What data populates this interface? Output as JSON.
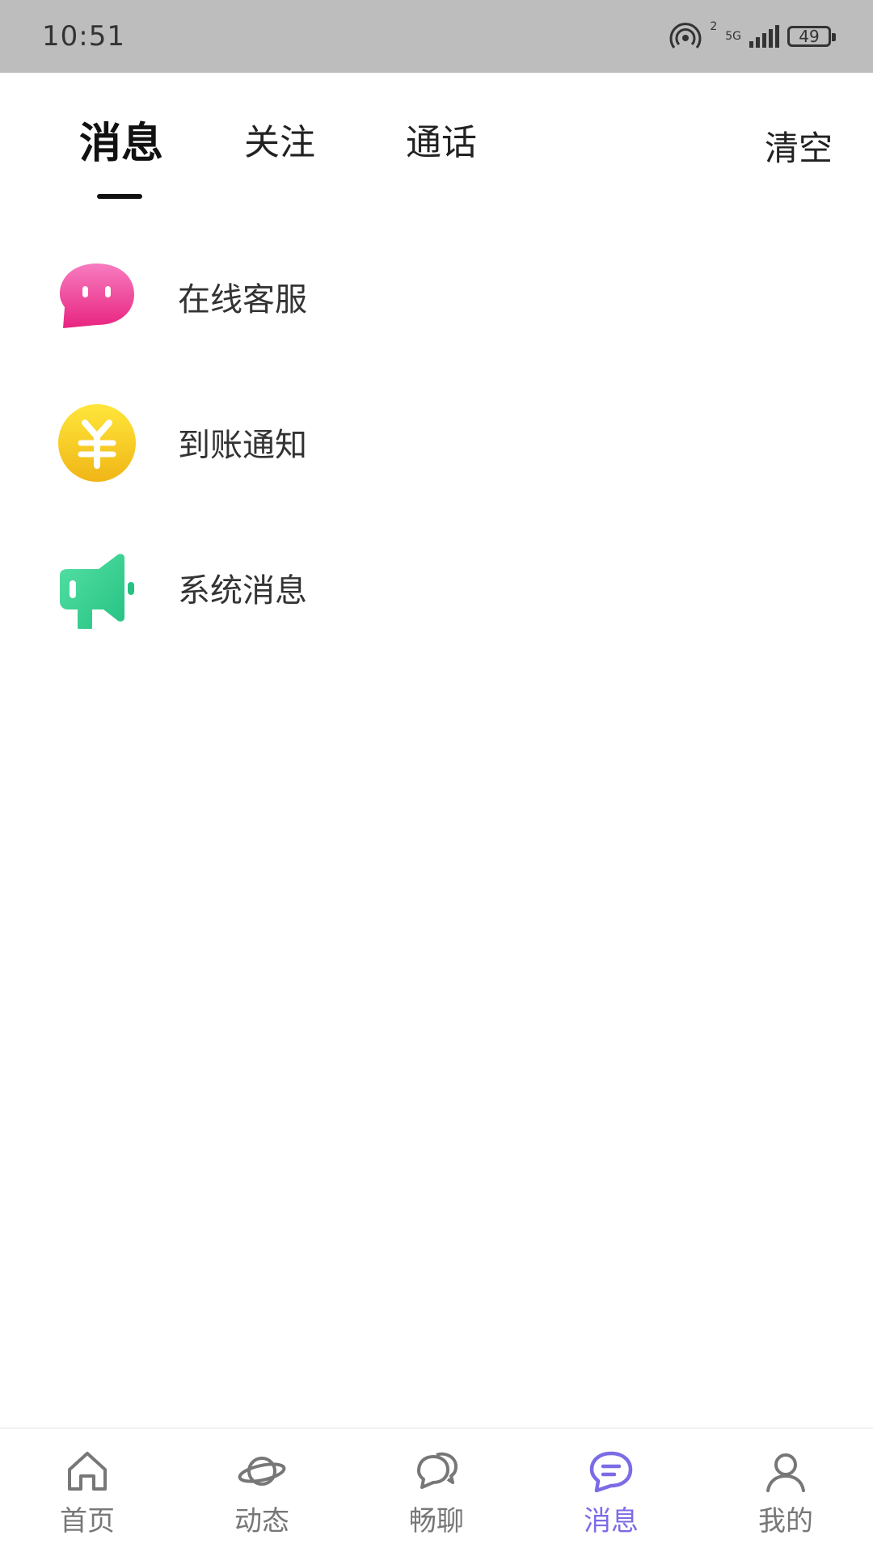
{
  "status_bar": {
    "time": "10:51",
    "net_sup": "2",
    "net_type": "5G",
    "battery": "49"
  },
  "tabs": [
    {
      "label": "消息",
      "active": true
    },
    {
      "label": "关注",
      "active": false
    },
    {
      "label": "通话",
      "active": false
    }
  ],
  "clear_label": "清空",
  "list": [
    {
      "label": "在线客服",
      "icon": "customer-service-bubble-icon",
      "color": "#ee3f9a"
    },
    {
      "label": "到账通知",
      "icon": "yuan-coin-icon",
      "color": "#f2c21d"
    },
    {
      "label": "系统消息",
      "icon": "megaphone-icon",
      "color": "#2fcf8f"
    }
  ],
  "bottom_nav": [
    {
      "label": "首页",
      "icon": "home-icon",
      "active": false
    },
    {
      "label": "动态",
      "icon": "planet-icon",
      "active": false
    },
    {
      "label": "畅聊",
      "icon": "chat-bubbles-icon",
      "active": false
    },
    {
      "label": "消息",
      "icon": "message-icon",
      "active": true
    },
    {
      "label": "我的",
      "icon": "profile-icon",
      "active": false
    }
  ],
  "colors": {
    "accent": "#7b6ce6",
    "status_bar_bg": "#bdbdbd"
  }
}
